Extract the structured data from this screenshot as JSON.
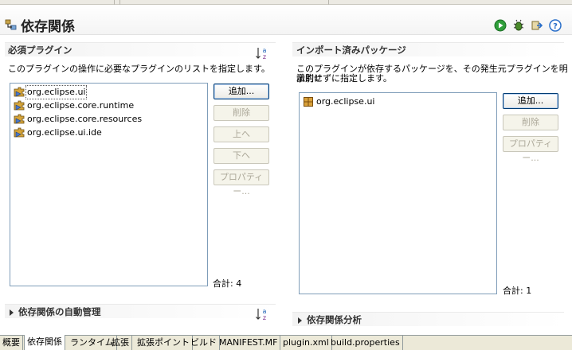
{
  "header": {
    "title": "依存関係"
  },
  "required": {
    "title": "必須プラグイン",
    "description": "このプラグインの操作に必要なプラグインのリストを指定します。",
    "items": [
      "org.eclipse.ui",
      "org.eclipse.core.runtime",
      "org.eclipse.core.resources",
      "org.eclipse.ui.ide"
    ],
    "buttons": {
      "add": "追加...",
      "remove": "削除",
      "up": "上へ",
      "down": "下へ",
      "properties": "プロパティー..."
    },
    "total": "合計: 4"
  },
  "imported": {
    "title": "インポート済みパッケージ",
    "description_line1": "このプラグインが依存するパッケージを、その発生元プラグインを明示的に",
    "description_line2": "識別せずに指定します。",
    "items": [
      "org.eclipse.ui"
    ],
    "buttons": {
      "add": "追加...",
      "remove": "削除",
      "properties": "プロパティー..."
    },
    "total": "合計: 1"
  },
  "auto_manage": {
    "title": "依存関係の自動管理"
  },
  "analysis": {
    "title": "依存関係分析"
  },
  "tabs": [
    "概要",
    "依存関係",
    "ランタイム",
    "拡張",
    "拡張ポイント",
    "ビルド",
    "MANIFEST.MF",
    "plugin.xml",
    "build.properties"
  ],
  "active_tab": "依存関係",
  "icons": {
    "header": "dependencies-icon",
    "run": "run-icon",
    "debug": "debug-icon",
    "export": "export-wizard-icon",
    "help": "help-icon",
    "sort": "sort-alphabetically-icon",
    "plugin": "plugin-icon",
    "package": "package-icon"
  },
  "colors": {
    "accent": "#003c74",
    "list_border": "#7f9db9",
    "run_green": "#2f9e3a",
    "help_blue": "#2a6fc9"
  }
}
